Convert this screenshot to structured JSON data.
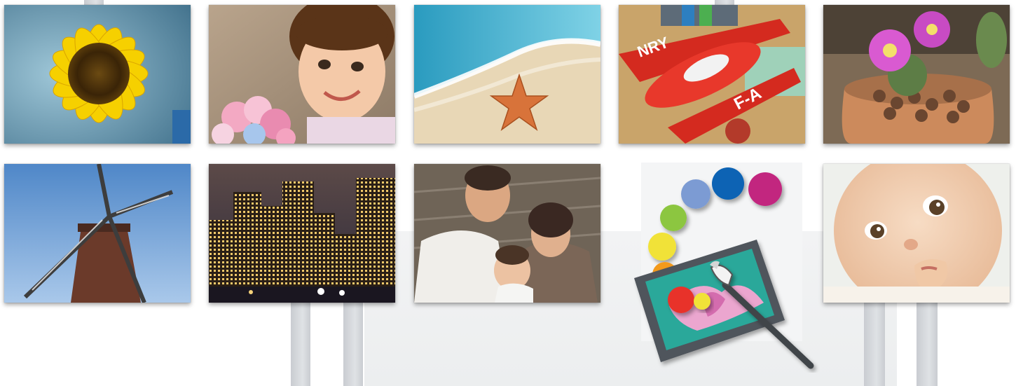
{
  "photos": [
    {
      "name": "sunflower",
      "row": 1,
      "col": 1
    },
    {
      "name": "girl-with-flowers",
      "row": 1,
      "col": 2
    },
    {
      "name": "starfish-on-beach",
      "row": 1,
      "col": 3
    },
    {
      "name": "toy-airplane",
      "row": 1,
      "col": 4,
      "visible_text": "NRY  F-A"
    },
    {
      "name": "flowering-cactus",
      "row": 1,
      "col": 5
    },
    {
      "name": "windmill",
      "row": 2,
      "col": 1
    },
    {
      "name": "city-skyline-night",
      "row": 2,
      "col": 2
    },
    {
      "name": "family-portrait",
      "row": 2,
      "col": 3
    },
    {
      "name": "paint-palette-icon",
      "row": 2,
      "col": 4
    },
    {
      "name": "baby-face",
      "row": 2,
      "col": 5
    }
  ],
  "colors": {
    "background": "#ffffff",
    "dot_colors": [
      "#e8322b",
      "#f39a1e",
      "#f1e237",
      "#8cc63f",
      "#7b9bd3",
      "#0a64b4",
      "#c2267f"
    ],
    "canvas_frame": "#555a60",
    "canvas_fill": "#2aa89a"
  }
}
